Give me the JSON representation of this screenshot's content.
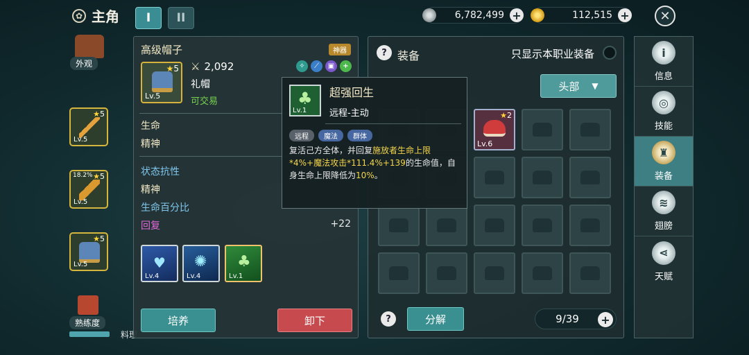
{
  "header": {
    "title": "主角",
    "tab1": "I",
    "tab2": "II"
  },
  "currency": {
    "silver": "6,782,499",
    "gold": "112,515"
  },
  "left": {
    "appearance_label": "外观",
    "slots": [
      {
        "stars": "5",
        "level": "Lv.5",
        "pct": ""
      },
      {
        "stars": "5",
        "level": "Lv.5",
        "pct": "18.2%"
      },
      {
        "stars": "5",
        "level": "Lv.5",
        "pct": ""
      }
    ],
    "proficiency_label": "熟练度",
    "material_label": "料理"
  },
  "detail": {
    "name": "高级帽子",
    "tag": "神器",
    "stars": "5",
    "level": "Lv.5",
    "power": "2,092",
    "subname": "礼帽",
    "tradable": "可交易",
    "stats": [
      {
        "label": "生命",
        "value": "",
        "color": "#f3e9c6"
      },
      {
        "label": "精神",
        "value": "",
        "color": "#f3e9c6"
      },
      {
        "label": "状态抗性",
        "value": "",
        "color": "#7fc7ee"
      },
      {
        "label": "精神",
        "value": "",
        "color": "#f3e9c6"
      },
      {
        "label": "生命百分比",
        "value": "",
        "color": "#7fc7ee"
      },
      {
        "label": "回复",
        "value": "+22",
        "color": "#e169d8"
      }
    ],
    "skills": [
      {
        "level": "Lv.4"
      },
      {
        "level": "Lv.4"
      },
      {
        "level": "Lv.1"
      }
    ],
    "train_button": "培养",
    "unequip_button": "卸下"
  },
  "tooltip": {
    "name": "超强回生",
    "level": "Lv.1",
    "type": "远程-主动",
    "chips": [
      "远程",
      "魔法",
      "群体"
    ],
    "desc_a": "复活己方全体，并回复",
    "desc_b": "施放者生命上限*4%+魔法攻击*111.4%+139",
    "desc_c": "的生命值，自身生命上限降低为",
    "desc_d": "10%",
    "desc_e": "。"
  },
  "equip": {
    "title": "装备",
    "filter_label": "只显示本职业装备",
    "dropdown": "头部",
    "item": {
      "stars": "2",
      "level": "Lv.6"
    },
    "decompose": "分解",
    "count": "9/39"
  },
  "nav": [
    {
      "label": "信息",
      "icon": "info-icon"
    },
    {
      "label": "技能",
      "icon": "skill-icon"
    },
    {
      "label": "装备",
      "icon": "armor-icon"
    },
    {
      "label": "翅膀",
      "icon": "wings-icon"
    },
    {
      "label": "天赋",
      "icon": "talent-icon"
    }
  ]
}
